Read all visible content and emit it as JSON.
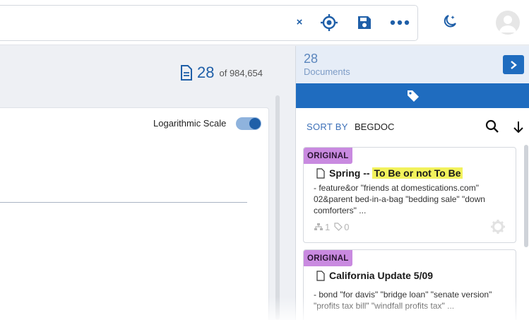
{
  "toolbar": {
    "clear_label": "×",
    "icons": [
      "close-icon",
      "crosshair-icon",
      "save-icon",
      "more-icon",
      "moon-icon",
      "avatar-icon"
    ]
  },
  "left": {
    "count_value": "28",
    "count_of": "of 984,654",
    "chart": {
      "log_scale_label": "Logarithmic Scale",
      "log_scale_on": true
    }
  },
  "right": {
    "docs_count": "28",
    "docs_label": "Documents",
    "sort_by_label": "SORT BY",
    "sort_field": "BEGDOC",
    "documents": [
      {
        "badge": "ORIGINAL",
        "title_prefix": "Spring -- ",
        "title_highlight": "To Be or not To Be",
        "snippet": "- feature&or \"friends at domestications.com\" 02&parent bed-in-a-bag \"bedding sale\" \"down comforters\" ...",
        "thread_count": "1",
        "tag_count": "0"
      },
      {
        "badge": "ORIGINAL",
        "title": "California Update 5/09",
        "snippet": "- bond \"for davis\" \"bridge loan\" \"senate version\" \"profits tax bill\" \"windfall profits tax\" ..."
      }
    ]
  },
  "colors": {
    "accent": "#1f6cbf",
    "badge": "#c98ae0",
    "highlight": "#f2f25c"
  }
}
